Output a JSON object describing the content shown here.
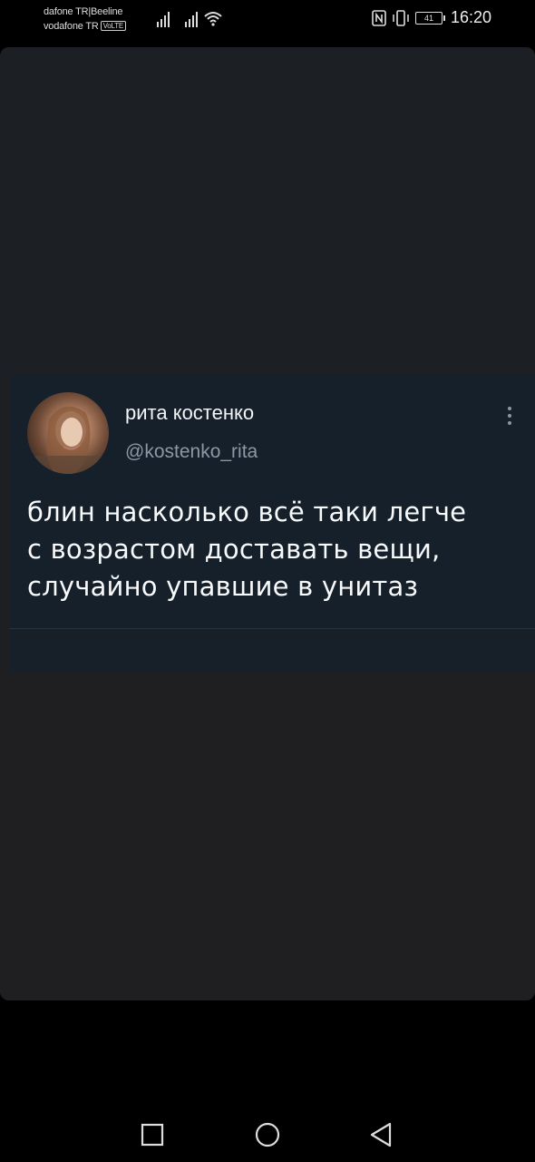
{
  "status_bar": {
    "carrier_line1": "dafone TR|Beeline",
    "carrier_line2": "vodafone TR",
    "volte_badge": "VoLTE",
    "battery_level": "41",
    "time": "16:20"
  },
  "tweet": {
    "display_name": "рита костенко",
    "handle": "@kostenko_rita",
    "text_lines": [
      "блин насколько всё таки легче",
      "с возрастом доставать вещи,",
      "случайно упавшие в унитаз"
    ]
  },
  "icons": {
    "signal1": "signal-icon",
    "signal2": "signal-icon",
    "wifi": "wifi-icon",
    "nfc": "nfc-icon",
    "vibrate": "vibrate-icon",
    "battery": "battery-icon",
    "more": "more-vertical-icon",
    "recent": "square-icon",
    "home": "circle-icon",
    "back": "triangle-back-icon"
  },
  "colors": {
    "tweet_bg": "#15202b",
    "name_color": "#f3f5f7",
    "handle_color": "#8b98a5"
  }
}
